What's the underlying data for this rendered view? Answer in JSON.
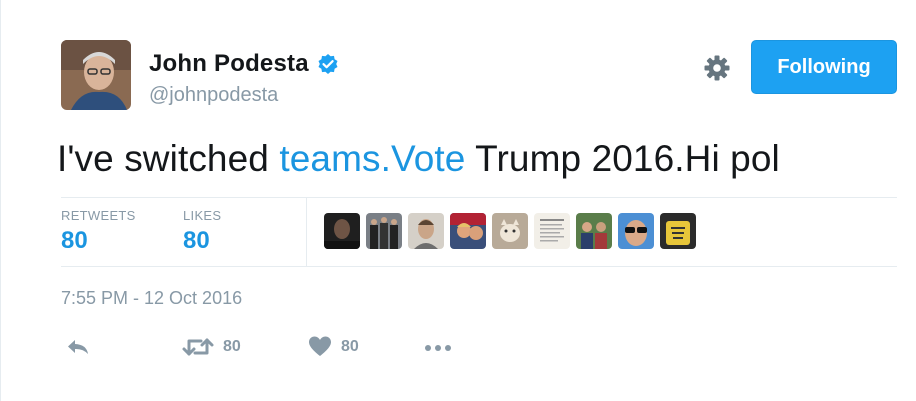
{
  "user": {
    "full_name": "John Podesta",
    "handle": "@johnpodesta",
    "verified": true
  },
  "follow_button": {
    "label": "Following"
  },
  "tweet": {
    "text_before": "I've switched ",
    "link_text": "teams.Vote",
    "text_after": " Trump 2016.Hi pol"
  },
  "stats": {
    "retweets_label": "RETWEETS",
    "retweets_value": "80",
    "likes_label": "LIKES",
    "likes_value": "80"
  },
  "timestamp": "7:55 PM - 12 Oct 2016",
  "actions": {
    "retweet_count": "80",
    "like_count": "80"
  },
  "colors": {
    "accent": "#1da1f2",
    "link": "#1b95e0",
    "muted": "#8899a6",
    "divider": "#e6ecf0"
  }
}
